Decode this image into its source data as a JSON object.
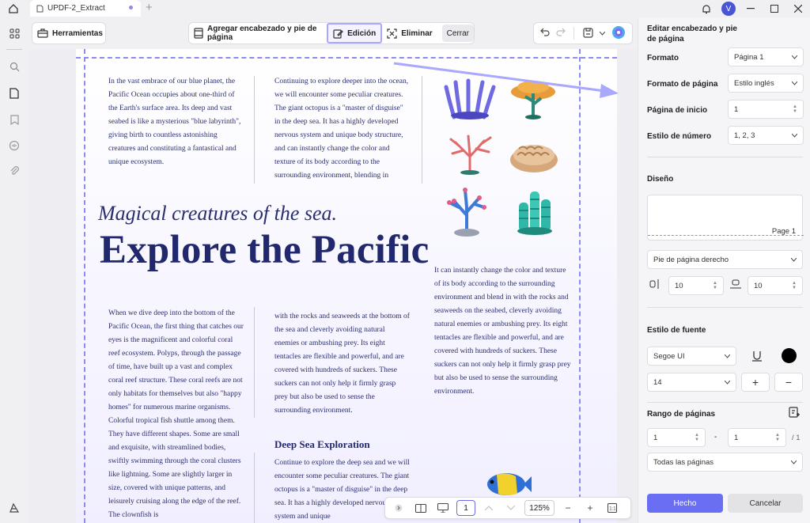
{
  "titlebar": {
    "tab_title": "UPDF-2_Extract",
    "avatar_letter": "V"
  },
  "toolbar": {
    "herramientas": "Herramientas",
    "header_footer": "Agregar encabezado y pie de página",
    "edicion": "Edición",
    "eliminar": "Eliminar",
    "cerrar": "Cerrar"
  },
  "document": {
    "col1_text": "In the vast embrace of our blue planet, the Pacific Ocean occupies about one-third of the Earth's surface area. Its deep and vast seabed is like a mysterious \"blue labyrinth\", giving birth to countless astonishing creatures and constituting a fantastical and unique ecosystem.",
    "col2_text": "Continuing to explore deeper into the ocean, we will encounter some peculiar creatures. The giant octopus is a \"master of disguise\" in the deep sea. It has a highly developed nervous system and unique body structure, and can instantly change the color and texture of its body according to the surrounding environment, blending in",
    "magical": "Magical creatures of the sea.",
    "explore": "Explore the Pacific",
    "col3_text": "It can instantly change the color and texture of its body according to the surrounding environment and blend in with the rocks and seaweeds on the seabed, cleverly avoiding natural enemies or ambushing prey. Its eight tentacles are flexible and powerful, and are covered with hundreds of suckers. These suckers can not only help it firmly grasp prey but also be used to sense the surrounding environment.",
    "col4_text": "When we dive deep into the bottom of the Pacific Ocean, the first thing that catches our eyes is the magnificent and colorful coral reef ecosystem. Polyps, through the passage of time, have built up a vast and complex coral reef structure. These coral reefs are not only habitats for themselves but also \"happy homes\" for numerous marine organisms. Colorful tropical fish shuttle among them. They have different shapes. Some are small and exquisite, with streamlined bodies, swiftly swimming through the coral clusters like lightning. Some are slightly larger in size, covered with unique patterns, and leisurely cruising along the edge of the reef. The clownfish is",
    "col5_text": "with the rocks and seaweeds at the bottom of the sea and cleverly avoiding natural enemies or ambushing prey. Its eight tentacles are flexible and powerful, and are covered with hundreds of suckers. These suckers can not only help it firmly grasp prey but also be used to sense the surrounding environment.",
    "deep_title": "Deep Sea Exploration",
    "col6_text": "Continue to explore the deep sea and we will encounter some peculiar creatures. The giant octopus is a \"master of disguise\" in the deep sea. It has a highly developed nervous system and unique"
  },
  "zoombar": {
    "page": "1",
    "zoom": "125%"
  },
  "panel": {
    "title": "Editar encabezado y pie de página",
    "formato_label": "Formato",
    "formato_value": "Página 1",
    "formato_pagina_label": "Formato de página",
    "formato_pagina_value": "Estilo inglés",
    "pagina_inicio_label": "Página de inicio",
    "pagina_inicio_value": "1",
    "estilo_numero_label": "Estilo de número",
    "estilo_numero_value": "1, 2, 3",
    "diseno_label": "Diseño",
    "preview_text": "Page 1",
    "position_value": "Pie de página derecho",
    "margin_left_value": "10",
    "margin_bottom_value": "10",
    "estilo_fuente_label": "Estilo de fuente",
    "font_value": "Segoe UI",
    "size_value": "14",
    "font_color": "#000000",
    "rango_label": "Rango de páginas",
    "range_from": "1",
    "range_dash": "-",
    "range_to": "1",
    "range_total": "/ 1",
    "pages_value": "Todas las páginas",
    "hecho": "Hecho",
    "cancelar": "Cancelar"
  },
  "colors": {
    "accent": "#6a6ef2",
    "highlight": "#a9a8ff",
    "doc_text": "#2a2e6e"
  }
}
